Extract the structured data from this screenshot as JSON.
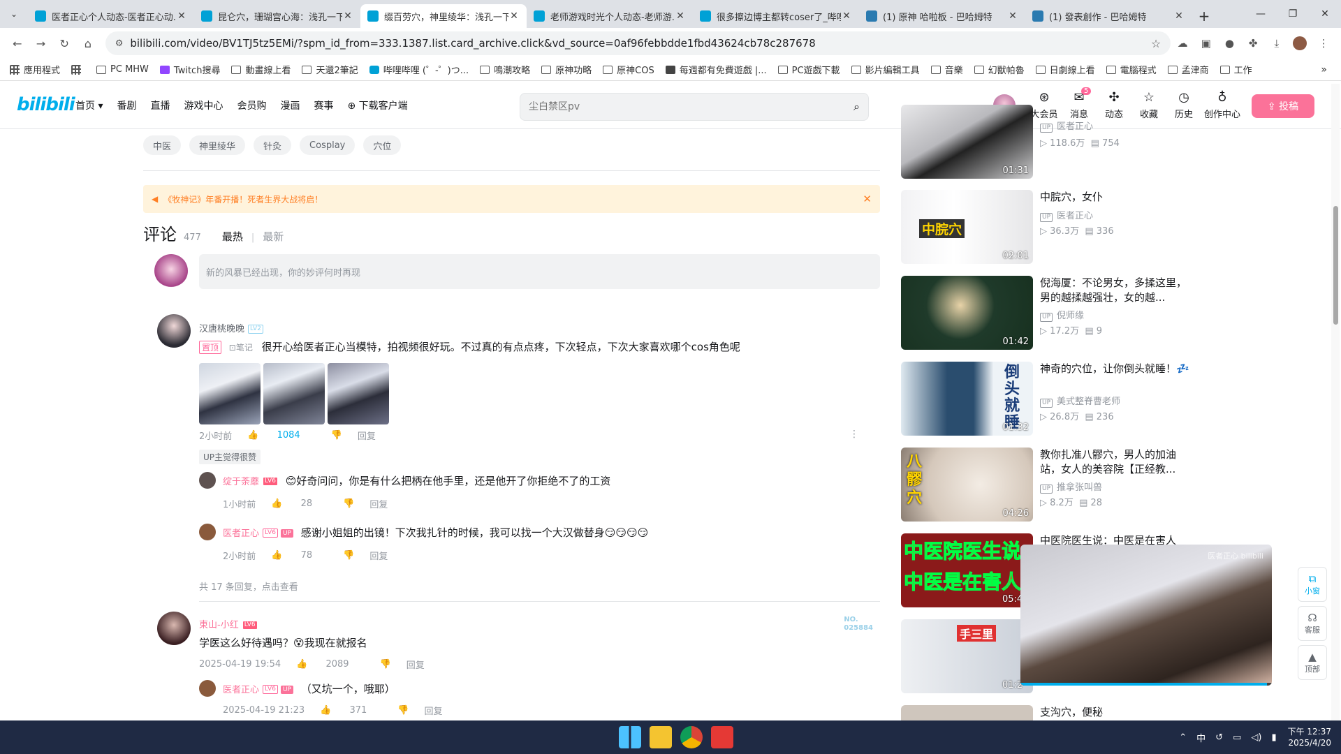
{
  "browser": {
    "tabs": [
      {
        "title": "医者正心个人动态-医者正心动...",
        "icon": "bilibili"
      },
      {
        "title": "昆仑穴，珊瑚宫心海：浅孔一下",
        "icon": "bilibili"
      },
      {
        "title": "缀百劳穴，神里绫华：浅孔一下",
        "icon": "bilibili",
        "active": true
      },
      {
        "title": "老师游戏时光个人动态-老师游...",
        "icon": "bilibili"
      },
      {
        "title": "很多擦边博主都转coser了_哔哩...",
        "icon": "bilibili"
      },
      {
        "title": "(1) 原神 哈啦板 - 巴哈姆特",
        "icon": "wiki"
      },
      {
        "title": "(1) 發表創作 - 巴哈姆特",
        "icon": "wiki"
      }
    ],
    "url": "bilibili.com/video/BV1TJ5tz5EMi/?spm_id_from=333.1387.list.card_archive.click&vd_source=0af96febbdde1fbd43624cb78c287678",
    "bookmarks": [
      "應用程式",
      "",
      "PC MHW",
      "Twitch搜尋",
      "動畫線上看",
      "天還2筆記",
      "哔哩哔哩 (゜-゜)つ...",
      "鳴潮攻略",
      "原神功略",
      "原神COS",
      "每週都有免費遊戲 |...",
      "PC遊戲下載",
      "影片編輯工具",
      "音樂",
      "幻獸帕魯",
      "日劇線上看",
      "電腦程式",
      "孟津商",
      "工作"
    ]
  },
  "header": {
    "logo": "bilibili",
    "nav": [
      "首页 ▾",
      "番剧",
      "直播",
      "游戏中心",
      "会员购",
      "漫画",
      "赛事",
      "⊕ 下载客户端"
    ],
    "search_placeholder": "尘白禁区pv",
    "icons": [
      {
        "label": "大会员",
        "icon": "vip-icon",
        "glyph": "⊛"
      },
      {
        "label": "消息",
        "icon": "message-icon",
        "glyph": "✉",
        "badge": "5"
      },
      {
        "label": "动态",
        "icon": "dynamic-icon",
        "glyph": "✣"
      },
      {
        "label": "收藏",
        "icon": "star-icon",
        "glyph": "☆"
      },
      {
        "label": "历史",
        "icon": "history-icon",
        "glyph": "◷"
      },
      {
        "label": "创作中心",
        "icon": "bulb-icon",
        "glyph": "♁"
      }
    ],
    "upload_label": "⇪ 投稿"
  },
  "tags": [
    "中医",
    "神里绫华",
    "针灸",
    "Cosplay",
    "穴位"
  ],
  "notice": "《牧神记》年番开播！死者生界大战将启！",
  "comments_header": {
    "title": "评论",
    "count": "477",
    "sort_hot": "最热",
    "sort_new": "最新"
  },
  "editor_placeholder": "新的风暴已经出现，你的妙评何时再现",
  "comments": [
    {
      "user": "汉唐桃晚晚",
      "level": "LV2",
      "pinned": "置顶",
      "note": "笔记",
      "text": "很开心给医者正心当模特，拍视频很好玩。不过真的有点点疼，下次轻点，下次大家喜欢哪个cos角色呢",
      "time": "2小时前",
      "likes": "1084",
      "reply": "回复",
      "up_liked": "UP主觉得很赞",
      "replies": [
        {
          "user": "绽于荼蘼",
          "level": "LV6",
          "text": "😊好奇问问，你是有什么把柄在他手里，还是他开了你拒绝不了的工资",
          "time": "1小时前",
          "likes": "28",
          "reply": "回复"
        },
        {
          "user": "医者正心",
          "level": "LV6",
          "up": "UP",
          "text": "感谢小姐姐的出镜！下次我扎针的时候，我可以找一个大汉做替身😏😏😏😏",
          "time": "2小时前",
          "likes": "78",
          "reply": "回复"
        }
      ],
      "more": "共 17 条回复，点击查看"
    },
    {
      "user": "東山-小红",
      "level": "LV6",
      "text": "学医这么好待遇吗？😵我现在就报名",
      "time": "2025-04-19 19:54",
      "likes": "2089",
      "reply": "回复",
      "fan_no": "NO.",
      "fan_num": "025884",
      "replies": [
        {
          "user": "医者正心",
          "level": "LV6",
          "up": "UP",
          "text": "（又坑一个，哦耶）",
          "time": "2025-04-19 21:23",
          "likes": "371",
          "reply": "回复"
        }
      ]
    }
  ],
  "recommendations": [
    {
      "title": "",
      "up": "医者正心",
      "views": "118.6万",
      "danmaku": "754",
      "duration": "01:31"
    },
    {
      "title": "中脘穴，女仆",
      "up": "医者正心",
      "views": "36.3万",
      "danmaku": "336",
      "duration": "02:01"
    },
    {
      "title": "倪海厦：不论男女，多揉这里，男的越揉越强壮，女的越...",
      "up": "倪师缘",
      "views": "17.2万",
      "danmaku": "9",
      "duration": "01:42"
    },
    {
      "title": "神奇的穴位，让你倒头就睡！💤",
      "up": "美式整脊曹老师",
      "views": "26.8万",
      "danmaku": "236",
      "duration": "01:32"
    },
    {
      "title": "教你扎准八髎穴，男人的加油站，女人的美容院【正经教...",
      "up": "推拿张叫兽",
      "views": "8.2万",
      "danmaku": "28",
      "duration": "04:26"
    },
    {
      "title": "中医院医生说：中医是在害人",
      "up": "",
      "views": "",
      "danmaku": "",
      "duration": "05:4"
    },
    {
      "title": "",
      "up": "",
      "views": "",
      "danmaku": "",
      "duration": "01:2"
    },
    {
      "title": "支沟穴，便秘",
      "up": "",
      "views": "",
      "danmaku": "",
      "duration": ""
    }
  ],
  "thumb_texts": {
    "t1": "中脘穴",
    "t3": "倒头就睡",
    "t4": "八髎穴",
    "t5a": "中医院医生说",
    "t5b": "中医是在害人",
    "t6": "手三里"
  },
  "miniplayer": {
    "logo": "医者正心 bilibili",
    "progress": 0.98
  },
  "side_tools": [
    {
      "label": "小窗",
      "icon": "mini-window-icon",
      "glyph": "⧉"
    },
    {
      "label": "客服",
      "icon": "headset-icon",
      "glyph": "☊"
    },
    {
      "label": "顶部",
      "icon": "to-top-icon",
      "glyph": "▲"
    }
  ],
  "taskbar": {
    "ime": "中",
    "time": "下午 12:37",
    "date": "2025/4/20"
  }
}
